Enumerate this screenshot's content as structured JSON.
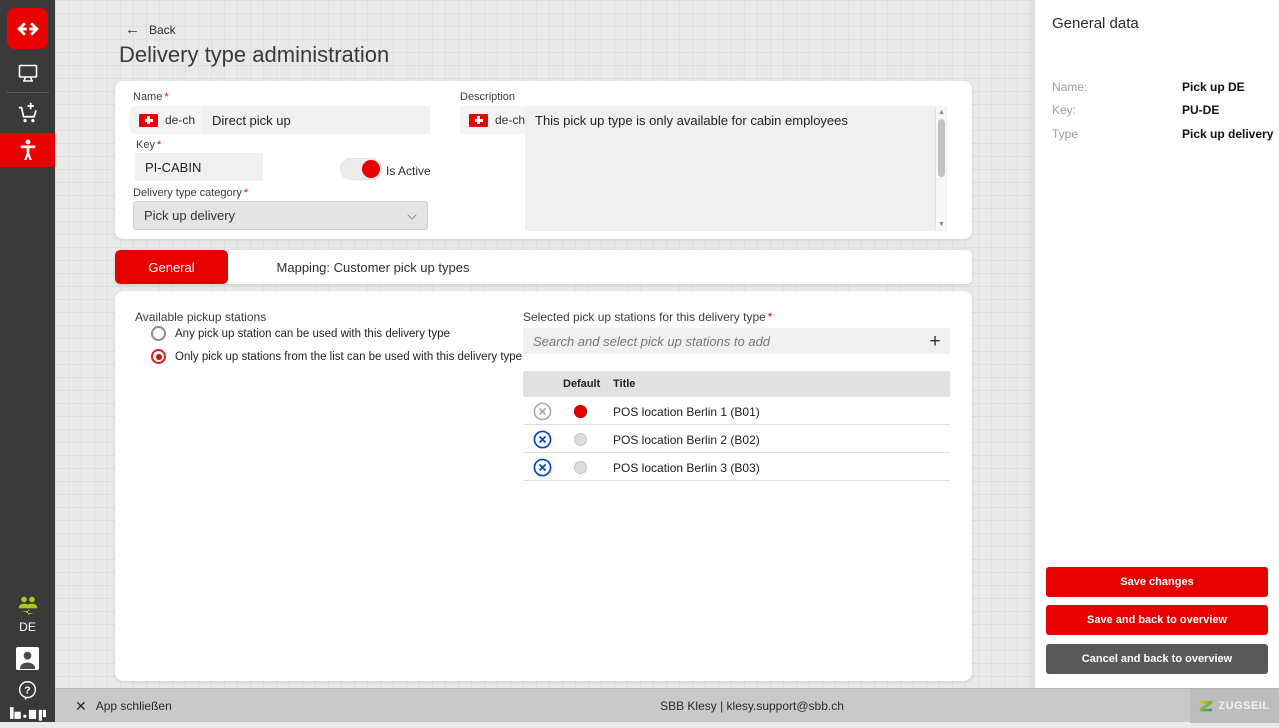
{
  "sidebar": {
    "language": "DE"
  },
  "header": {
    "back_label": "Back",
    "title": "Delivery type administration"
  },
  "required_marker": "*",
  "form": {
    "name": {
      "label": "Name",
      "lang": "de-ch",
      "value": "Direct pick up"
    },
    "key": {
      "label": "Key",
      "value": "PI-CABIN"
    },
    "is_active_label": "Is Active",
    "category": {
      "label": "Delivery type category",
      "value": "Pick up delivery"
    },
    "description": {
      "label": "Description",
      "lang": "de-ch",
      "value": "This pick up type is only available for cabin employees"
    }
  },
  "tabs": [
    {
      "label": "General",
      "active": true
    },
    {
      "label": "Mapping: Customer pick up types",
      "active": false
    }
  ],
  "stations": {
    "available_label": "Available pickup stations",
    "options": [
      {
        "label": "Any pick up station can be used with  this delivery type",
        "selected": false
      },
      {
        "label": "Only pick up stations from the list can be used with this delivery type",
        "selected": true
      }
    ],
    "selected_label": "Selected pick up stations for this delivery type",
    "search_placeholder": "Search and select pick up stations to add",
    "table": {
      "columns": [
        "Default",
        "Title"
      ],
      "rows": [
        {
          "title": "POS location Berlin 1 (B01)",
          "default": true,
          "removable": false
        },
        {
          "title": "POS location Berlin 2 (B02)",
          "default": false,
          "removable": true
        },
        {
          "title": "POS location Berlin 3 (B03)",
          "default": false,
          "removable": true
        }
      ]
    }
  },
  "side_panel": {
    "title": "General data",
    "fields": [
      {
        "label": "Name:",
        "value": "Pick up DE"
      },
      {
        "label": "Key:",
        "value": "PU-DE"
      },
      {
        "label": "Type",
        "value": "Pick up delivery"
      }
    ],
    "buttons": [
      {
        "label": "Save changes",
        "style": "primary"
      },
      {
        "label": "Save and back to overview",
        "style": "primary"
      },
      {
        "label": "Cancel and back to overview",
        "style": "secondary"
      }
    ]
  },
  "footer": {
    "close_label": "App schließen",
    "center_text": "SBB Klesy | klesy.support@sbb.ch",
    "brand": "ZUGSEIL"
  },
  "colors": {
    "sbb_red": "#eb0000",
    "action_red": "#e60000",
    "sidebar_bg": "#3a3a3a",
    "accent_green": "#afca0b",
    "remove_blue": "#0846c8"
  }
}
